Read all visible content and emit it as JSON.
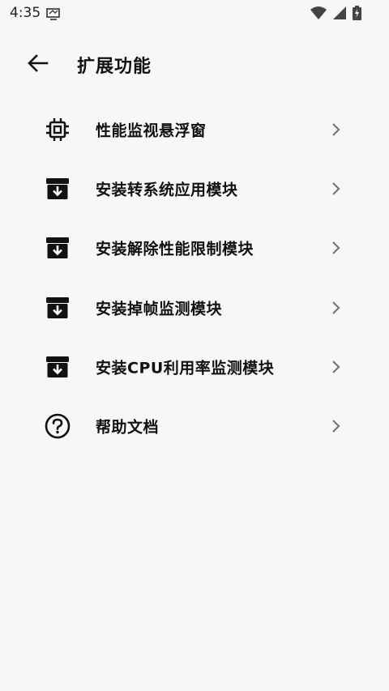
{
  "status_bar": {
    "time": "4:35",
    "icons": [
      "cast-icon",
      "wifi-icon",
      "signal-icon",
      "battery-charging-icon"
    ]
  },
  "header": {
    "title": "扩展功能",
    "back_icon": "arrow-left-icon"
  },
  "items": [
    {
      "label": "性能监视悬浮窗",
      "icon": "chip-icon"
    },
    {
      "label": "安装转系统应用模块",
      "icon": "archive-download-icon"
    },
    {
      "label": "安装解除性能限制模块",
      "icon": "archive-download-icon"
    },
    {
      "label": "安装掉帧监测模块",
      "icon": "archive-download-icon"
    },
    {
      "label": "安装CPU利用率监测模块",
      "icon": "archive-download-icon"
    },
    {
      "label": "帮助文档",
      "icon": "help-circle-icon"
    }
  ]
}
